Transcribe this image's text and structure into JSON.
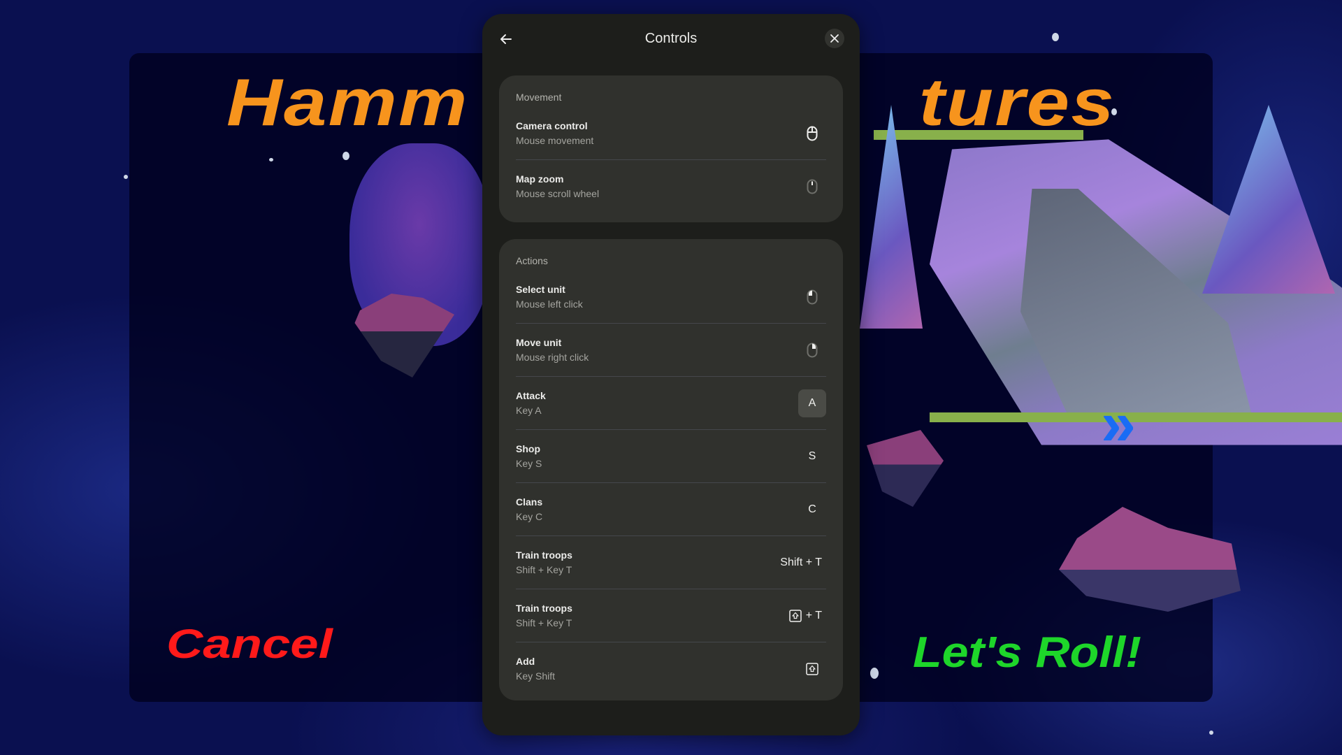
{
  "game": {
    "title_left": "Hamm",
    "title_right": "tures",
    "cancel_label": "Cancel",
    "confirm_label": "Let's Roll!",
    "chevron_glyph": "»",
    "colors": {
      "title": "#f7941d",
      "cancel": "#ff1a1a",
      "confirm": "#1ed62a"
    }
  },
  "dialog": {
    "title": "Controls",
    "back_icon": "arrow-left-icon",
    "close_icon": "close-icon",
    "sections": [
      {
        "label": "Movement",
        "rows": [
          {
            "title": "Camera control",
            "subtitle": "Mouse movement",
            "binding_icon": "mouse-icon"
          },
          {
            "title": "Map zoom",
            "subtitle": "Mouse scroll wheel",
            "binding_icon": "mouse-scroll-icon"
          }
        ]
      },
      {
        "label": "Actions",
        "rows": [
          {
            "title": "Select unit",
            "subtitle": "Mouse left click",
            "binding_icon": "mouse-left-click-icon"
          },
          {
            "title": "Move unit",
            "subtitle": "Mouse right click",
            "binding_icon": "mouse-right-click-icon"
          },
          {
            "title": "Attack",
            "subtitle": "Key A",
            "binding_key": "A"
          },
          {
            "title": "Shop",
            "subtitle": "Key S",
            "binding_key": "S"
          },
          {
            "title": "Clans",
            "subtitle": "Key C",
            "binding_key": "C"
          },
          {
            "title": "Train troops",
            "subtitle": "Shift + Key T",
            "binding_key": "Shift + T"
          },
          {
            "title": "Train troops",
            "subtitle": "Shift + Key T",
            "binding_icon": "shift-key-icon",
            "binding_suffix": "+ T"
          },
          {
            "title": "Add",
            "subtitle": "Key Shift",
            "binding_icon": "shift-key-icon"
          }
        ]
      }
    ]
  }
}
